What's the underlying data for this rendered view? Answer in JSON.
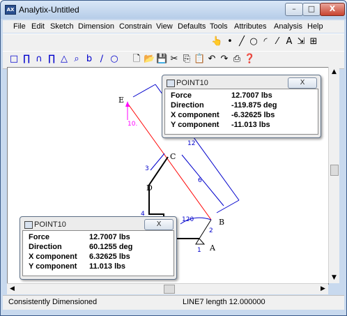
{
  "window": {
    "title": "Analytix-Untitled"
  },
  "window_buttons": {
    "minimize": "–",
    "maximize": "□",
    "close": "X"
  },
  "menus": [
    "File",
    "Edit",
    "Sketch",
    "Dimension",
    "Constrain",
    "View",
    "Defaults",
    "Tools",
    "Attributes",
    "Analysis",
    "Help"
  ],
  "toolbar_right_icons": [
    "cursor-arrow-icon",
    "point-icon",
    "line-icon",
    "circle-icon",
    "arc-icon",
    "dashed-line-icon",
    "text-A-icon",
    "dimension-icon",
    "fit-icon"
  ],
  "toolbar_left_icons": [
    "rect-icon",
    "frame-icon",
    "arch-icon",
    "truss-icon",
    "triangle-icon",
    "probe-icon",
    "lever-icon",
    "pen-icon",
    "spring-icon"
  ],
  "toolbar_file_icons": [
    "new-icon",
    "open-icon",
    "save-icon",
    "cut-icon",
    "copy-icon",
    "paste-icon",
    "undo-icon",
    "redo-icon",
    "print-icon",
    "help-icon"
  ],
  "drawing": {
    "labels": {
      "E": "E",
      "C": "C",
      "D": "D",
      "B": "B",
      "A": "A"
    },
    "dims": {
      "d12": "12",
      "d10": "10.",
      "d3": "3",
      "d6": "6",
      "d4": "4",
      "d120": "120",
      "d2": "2",
      "d1": "1"
    }
  },
  "popup_top": {
    "title": "POINT10",
    "close": "X",
    "rows": [
      {
        "label": "Force",
        "value": "12.7007 lbs"
      },
      {
        "label": "Direction",
        "value": "-119.875 deg"
      },
      {
        "label": "X component",
        "value": "-6.32625 lbs"
      },
      {
        "label": "Y component",
        "value": "-11.013 lbs"
      }
    ]
  },
  "popup_bottom": {
    "title": "POINT10",
    "close": "X",
    "rows": [
      {
        "label": "Force",
        "value": "12.7007 lbs"
      },
      {
        "label": "Direction",
        "value": "60.1255 deg"
      },
      {
        "label": "X component",
        "value": "6.32625 lbs"
      },
      {
        "label": "Y component",
        "value": "11.013 lbs"
      }
    ]
  },
  "status": {
    "left": "Consistently Dimensioned",
    "right": "LINE7 length 12.000000"
  },
  "colors": {
    "accent": "#0000cc",
    "force_line": "#ff0000",
    "magenta": "#ff00ff"
  }
}
